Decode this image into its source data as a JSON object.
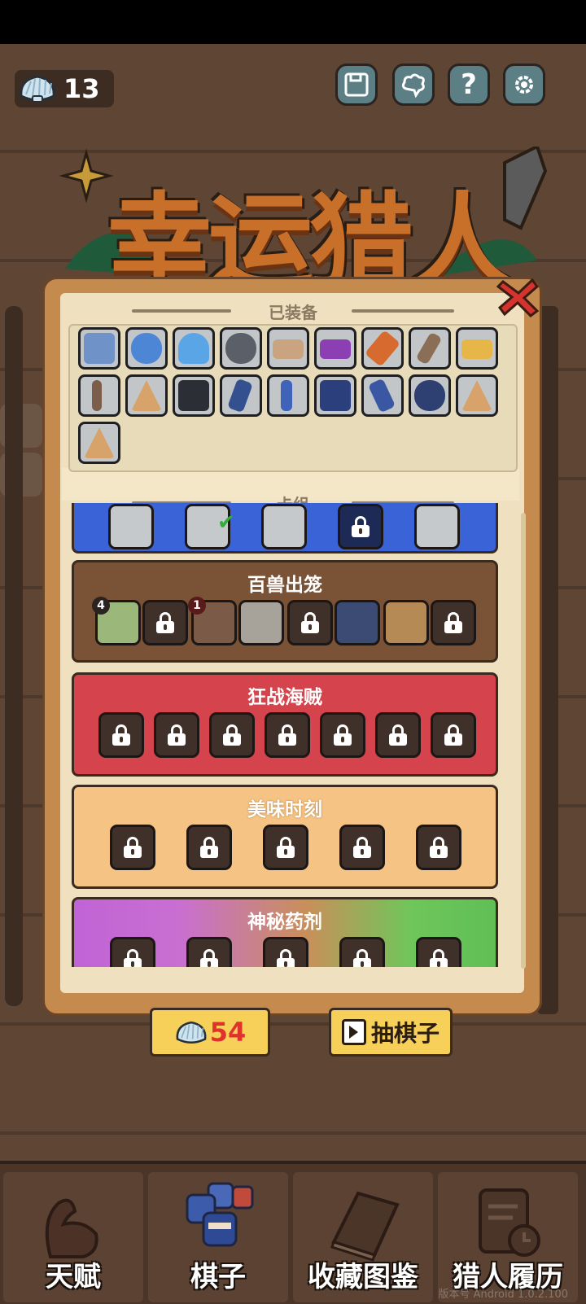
{
  "currency": {
    "shell_icon": "shell-icon",
    "amount": "13"
  },
  "top_buttons": [
    {
      "name": "save-button",
      "icon": "floppy-disk-icon"
    },
    {
      "name": "community-button",
      "icon": "cloud-face-icon"
    },
    {
      "name": "help-button",
      "icon": "question-icon",
      "glyph": "?"
    },
    {
      "name": "settings-button",
      "icon": "gear-icon"
    }
  ],
  "title": {
    "text": "幸运猎人"
  },
  "panel": {
    "equipped_header": "已装备",
    "deck_header": "卡组",
    "equipped_items": [
      "blue-ninja",
      "blue-question-mark",
      "blue-slime-king",
      "hooded-rogue",
      "treasure-chest",
      "purple-chest",
      "orange-link",
      "bone-wand",
      "golden-chest",
      "axe",
      "tent-with-ninja",
      "black-ninja",
      "blue-scroll",
      "blue-axe",
      "ninja-with-star",
      "blue-daggers",
      "helmet-ninja",
      "tent",
      "tent-sleeping"
    ],
    "decks": [
      {
        "title": "",
        "color": "#3b63d8"
      },
      {
        "title": "百兽出笼",
        "color": "#7a5236",
        "badges": [
          "4",
          "1"
        ]
      },
      {
        "title": "狂战海贼",
        "color": "#d5444c"
      },
      {
        "title": "美味时刻",
        "color": "#f5c384"
      },
      {
        "title": "神秘药剂",
        "color": "#c96fd1"
      }
    ]
  },
  "bottom_buttons": {
    "shell_cost": "54",
    "draw_label": "抽棋子"
  },
  "nav": [
    {
      "label": "天赋",
      "icon": "muscle-arm-icon"
    },
    {
      "label": "棋子",
      "icon": "ninja-pieces-icon"
    },
    {
      "label": "收藏图鉴",
      "icon": "book-icon"
    },
    {
      "label": "猎人履历",
      "icon": "clipboard-clock-icon"
    }
  ],
  "watermark": "版本号 Android 1.0.2.100"
}
